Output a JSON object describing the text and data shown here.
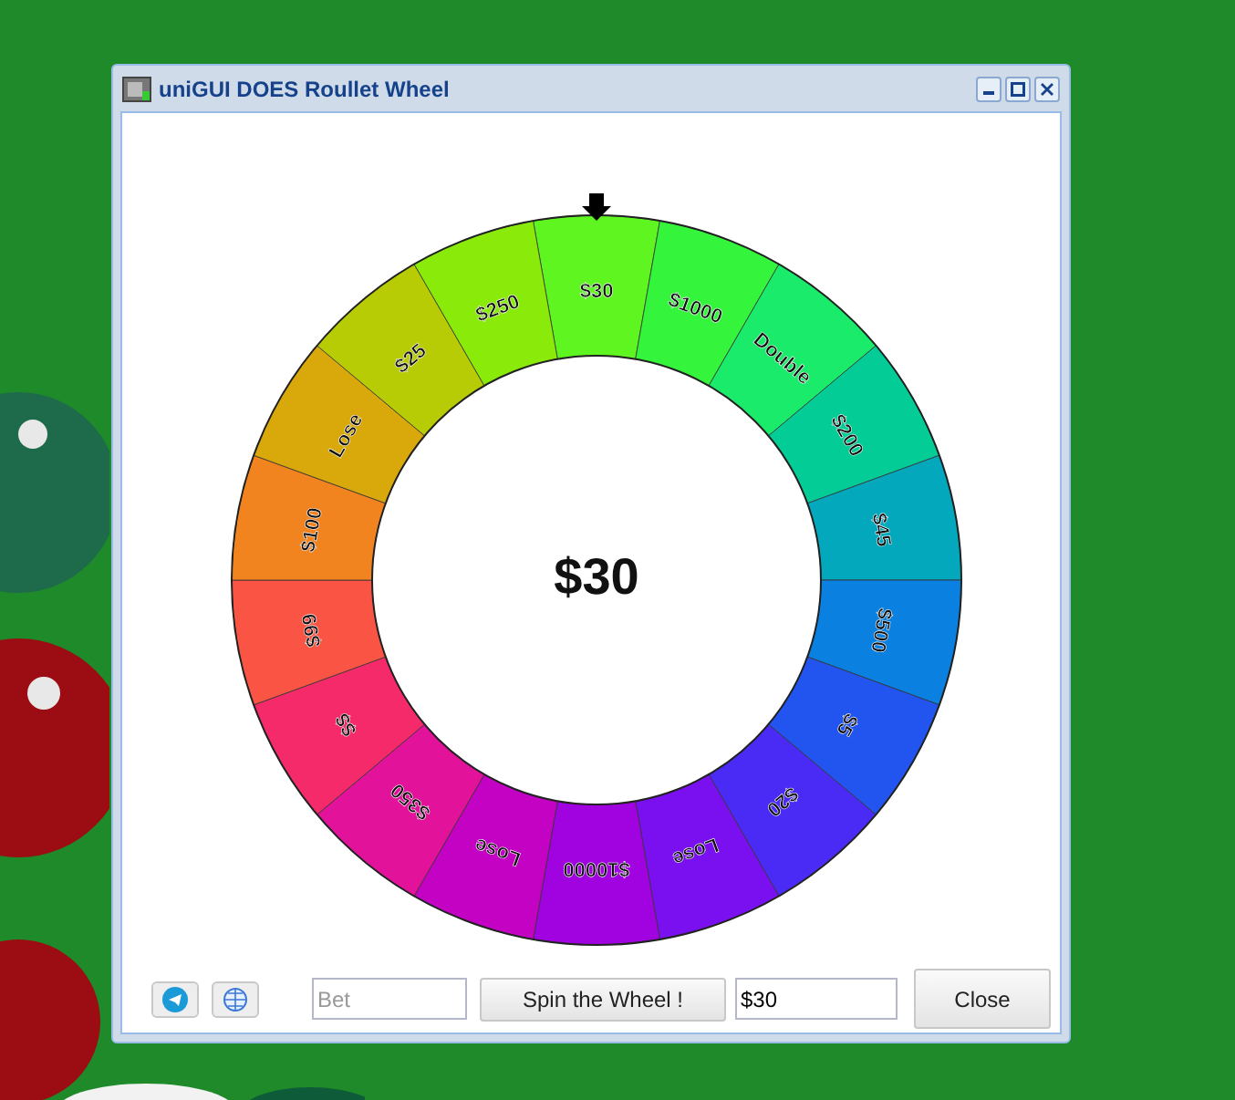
{
  "window": {
    "title": "uniGUI DOES Roullet Wheel"
  },
  "wheel": {
    "result": "$30",
    "segments": [
      {
        "label": "$30",
        "color": "#5ef520"
      },
      {
        "label": "$1000",
        "color": "#34f53c"
      },
      {
        "label": "Double",
        "color": "#1aeb6a"
      },
      {
        "label": "$200",
        "color": "#03cc96"
      },
      {
        "label": "$45",
        "color": "#03a8bd"
      },
      {
        "label": "$500",
        "color": "#0a80e0"
      },
      {
        "label": "$5",
        "color": "#2255f0"
      },
      {
        "label": "$20",
        "color": "#4a2bf5"
      },
      {
        "label": "Lose",
        "color": "#7a10f0"
      },
      {
        "label": "$10000",
        "color": "#a002e0"
      },
      {
        "label": "Lose",
        "color": "#c402c4"
      },
      {
        "label": "$350",
        "color": "#e2129a"
      },
      {
        "label": "$$",
        "color": "#f52a6b"
      },
      {
        "label": "$99",
        "color": "#fa5544"
      },
      {
        "label": "$100",
        "color": "#f28420"
      },
      {
        "label": "Lose",
        "color": "#d9a80a"
      },
      {
        "label": "$25",
        "color": "#b8cc05"
      },
      {
        "label": "$250",
        "color": "#8aeb0a"
      }
    ]
  },
  "toolbar": {
    "bet": {
      "placeholder": "Bet"
    },
    "spin_button": "Spin the Wheel !",
    "result_field": {
      "value": "$30"
    },
    "close_button": "Close"
  }
}
